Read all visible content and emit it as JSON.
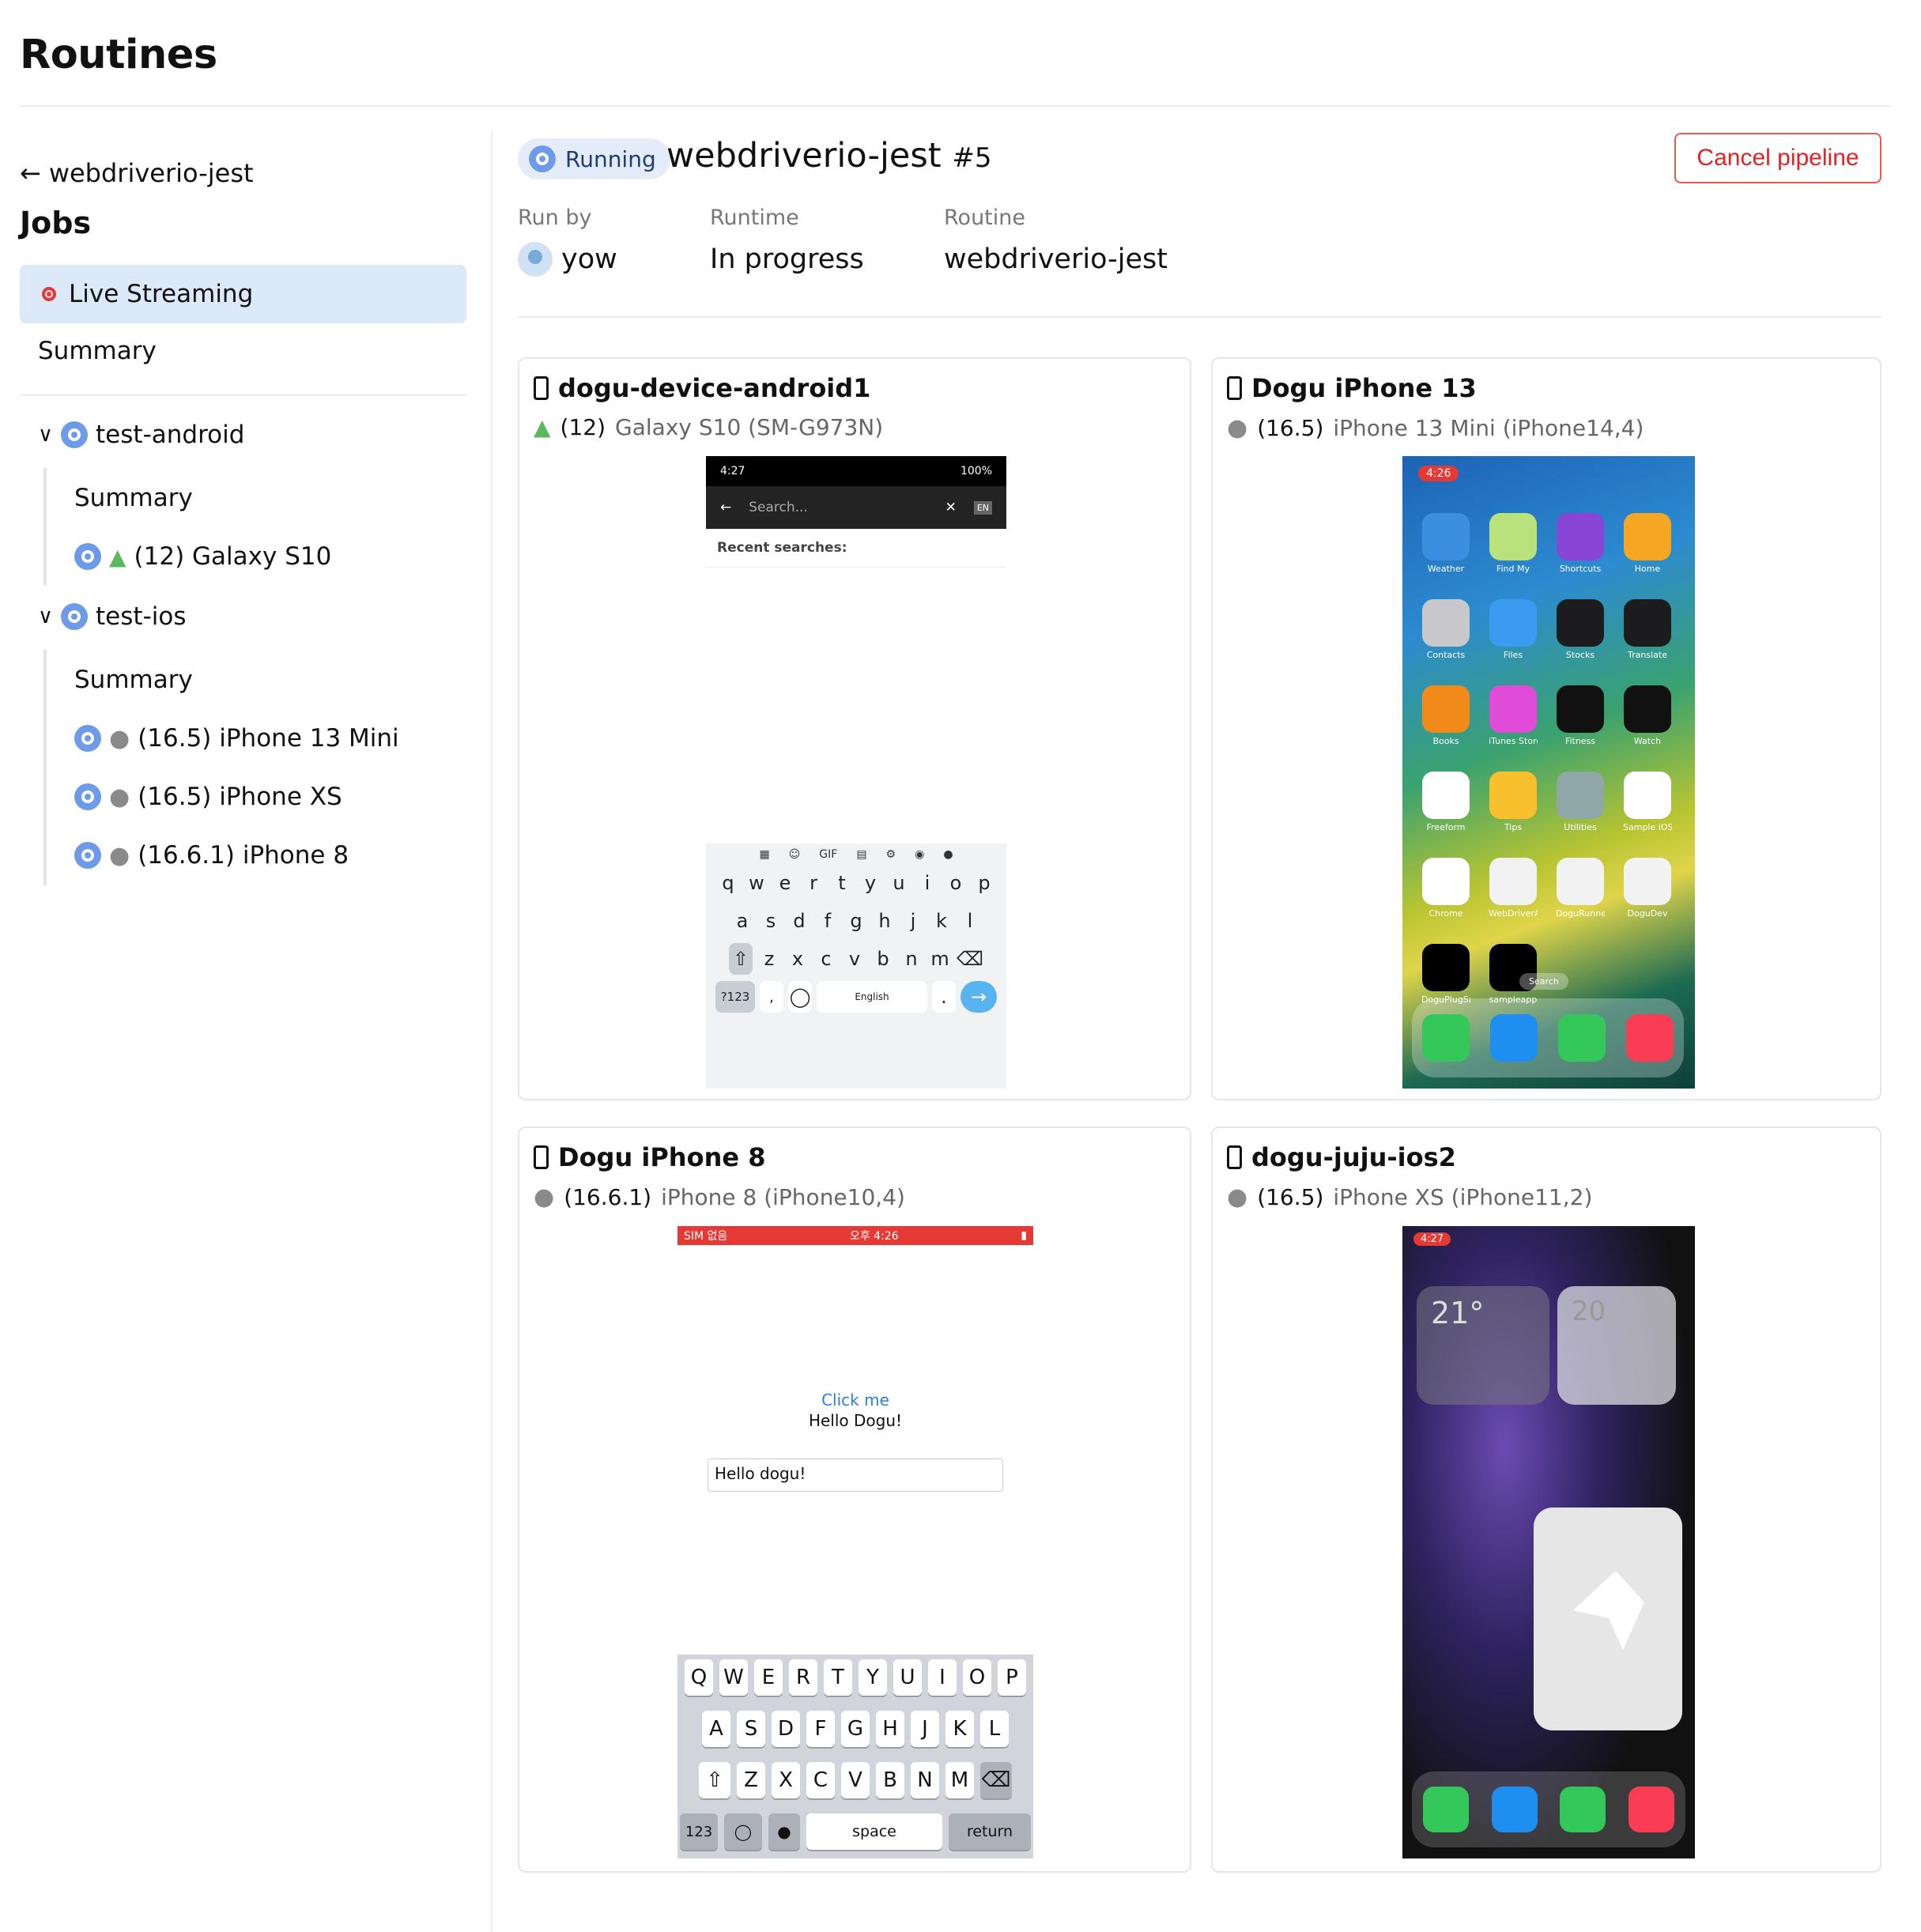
{
  "page": {
    "title": "Routines"
  },
  "sidebar": {
    "back_label": "webdriverio-jest",
    "jobs_heading": "Jobs",
    "live_streaming": "Live Streaming",
    "summary": "Summary",
    "groups": [
      {
        "name": "test-android",
        "summary": "Summary",
        "devices": [
          "(12) Galaxy S10"
        ]
      },
      {
        "name": "test-ios",
        "summary": "Summary",
        "devices": [
          "(16.5) iPhone 13 Mini",
          "(16.5) iPhone XS",
          "(16.6.1) iPhone 8"
        ]
      }
    ]
  },
  "header": {
    "status": "Running",
    "pipeline_name": "webdriverio-jest",
    "pipeline_number": "#5",
    "cancel_label": "Cancel pipeline",
    "run_by_label": "Run by",
    "run_by_value": "yow",
    "runtime_label": "Runtime",
    "runtime_value": "In progress",
    "routine_label": "Routine",
    "routine_value": "webdriverio-jest"
  },
  "devices": [
    {
      "name": "dogu-device-android1",
      "version": "(12)",
      "model": "Galaxy S10 (SM-G973N)",
      "os": "android"
    },
    {
      "name": "Dogu iPhone 13",
      "version": "(16.5)",
      "model": "iPhone 13 Mini (iPhone14,4)",
      "os": "ios"
    },
    {
      "name": "Dogu iPhone 8",
      "version": "(16.6.1)",
      "model": "iPhone 8 (iPhone10,4)",
      "os": "ios"
    },
    {
      "name": "dogu-juju-ios2",
      "version": "(16.5)",
      "model": "iPhone XS (iPhone11,2)",
      "os": "ios"
    }
  ],
  "screens": {
    "android": {
      "time": "4:27",
      "battery": "100%",
      "search_placeholder": "Search...",
      "lang_badge": "EN",
      "recent": "Recent searches:",
      "key_rows": [
        [
          "q",
          "w",
          "e",
          "r",
          "t",
          "y",
          "u",
          "i",
          "o",
          "p"
        ],
        [
          "a",
          "s",
          "d",
          "f",
          "g",
          "h",
          "j",
          "k",
          "l"
        ],
        [
          "z",
          "x",
          "c",
          "v",
          "b",
          "n",
          "m"
        ]
      ],
      "sym_key": "?123",
      "space_label": "English",
      "period": ".",
      "gif": "GIF"
    },
    "iphone13": {
      "time": "4:26",
      "apps": [
        "Weather",
        "Find My",
        "Shortcuts",
        "Home",
        "Contacts",
        "Files",
        "Stocks",
        "Translate",
        "Books",
        "iTunes Store",
        "Fitness",
        "Watch",
        "Freeform",
        "Tips",
        "Utilities",
        "Sample iOS",
        "Chrome",
        "WebDriverAge...",
        "DoguRunner-R...",
        "DoguDev",
        "DoguPlugSample",
        "sampleapp"
      ],
      "app_colors": [
        "#3b8fe0",
        "#b9e27c",
        "#8845d6",
        "#f5a623",
        "#c7c7cc",
        "#3a9bf0",
        "#1c1c1e",
        "#1c1c1e",
        "#f28a1a",
        "#e04bd7",
        "#111",
        "#111",
        "#fff",
        "#f7c02c",
        "#8fa7a6",
        "#fff",
        "#fff",
        "#f2f2f2",
        "#f2f2f2",
        "#f2f2f2",
        "#000",
        "#000"
      ],
      "search_label": "Search",
      "dock_colors": [
        "#34c759",
        "#1e8ef0",
        "#34c759",
        "#fa3c55"
      ]
    },
    "iphone8": {
      "carrier": "SIM 없음",
      "time": "오후 4:26",
      "link": "Click me",
      "hello": "Hello Dogu!",
      "input_value": "Hello dogu!",
      "rows": [
        [
          "Q",
          "W",
          "E",
          "R",
          "T",
          "Y",
          "U",
          "I",
          "O",
          "P"
        ],
        [
          "A",
          "S",
          "D",
          "F",
          "G",
          "H",
          "J",
          "K",
          "L"
        ],
        [
          "Z",
          "X",
          "C",
          "V",
          "B",
          "N",
          "M"
        ]
      ],
      "num_key": "123",
      "space_key": "space",
      "return_key": "return"
    },
    "iphonexs": {
      "time": "4:27",
      "widget_temp": "21°",
      "widget_date": "20"
    }
  },
  "colors": {
    "accent": "#6e9be8",
    "danger": "#e02424",
    "selected_bg": "#dbe9f8"
  }
}
